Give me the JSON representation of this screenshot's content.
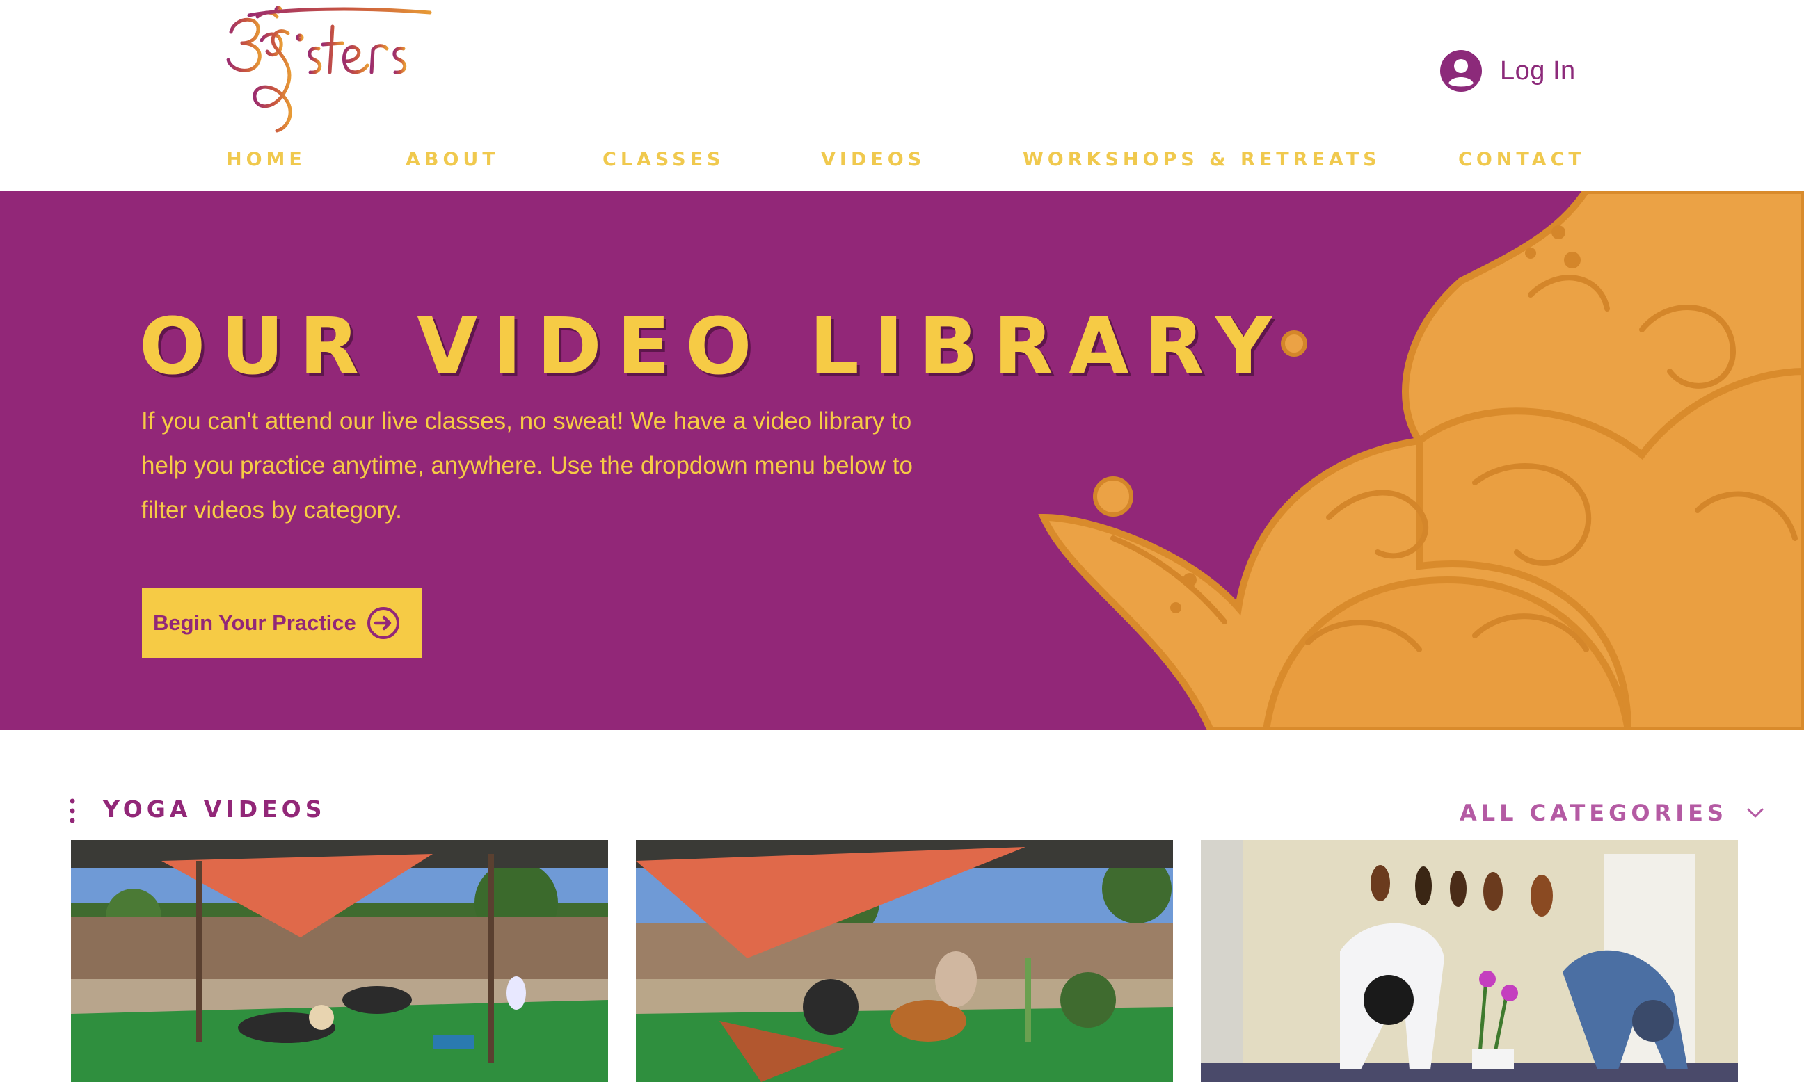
{
  "brand": {
    "logo_text": "3 sisters",
    "colors": {
      "purple": "#922778",
      "gold": "#f6cb45",
      "nav_gold": "#f0c94e",
      "orange": "#eba245"
    }
  },
  "header": {
    "login_label": "Log In",
    "login_icon": "user-avatar-icon"
  },
  "nav": {
    "items": [
      {
        "label": "HOME"
      },
      {
        "label": "ABOUT"
      },
      {
        "label": "CLASSES"
      },
      {
        "label": "VIDEOS"
      },
      {
        "label": "WORKSHOPS & RETREATS"
      },
      {
        "label": "CONTACT"
      }
    ]
  },
  "hero": {
    "title": "OUR VIDEO LIBRARY",
    "lines": [
      "If you can't attend our live classes, no sweat! We have a video library to",
      "help you practice anytime, anywhere. Use the dropdown menu below to",
      "filter videos by category."
    ],
    "cta_label": "Begin Your Practice",
    "cta_icon": "arrow-right-circle-icon"
  },
  "videos": {
    "section_title": "YOGA VIDEOS",
    "menu_icon": "vertical-dots-icon",
    "category_label": "ALL CATEGORIES",
    "category_icon": "chevron-down-icon",
    "thumbnails": [
      {
        "scene": "outdoor-yoga-shade-sail"
      },
      {
        "scene": "outdoor-yoga-downward-dog"
      },
      {
        "scene": "indoor-yoga-masks-wall"
      }
    ]
  }
}
